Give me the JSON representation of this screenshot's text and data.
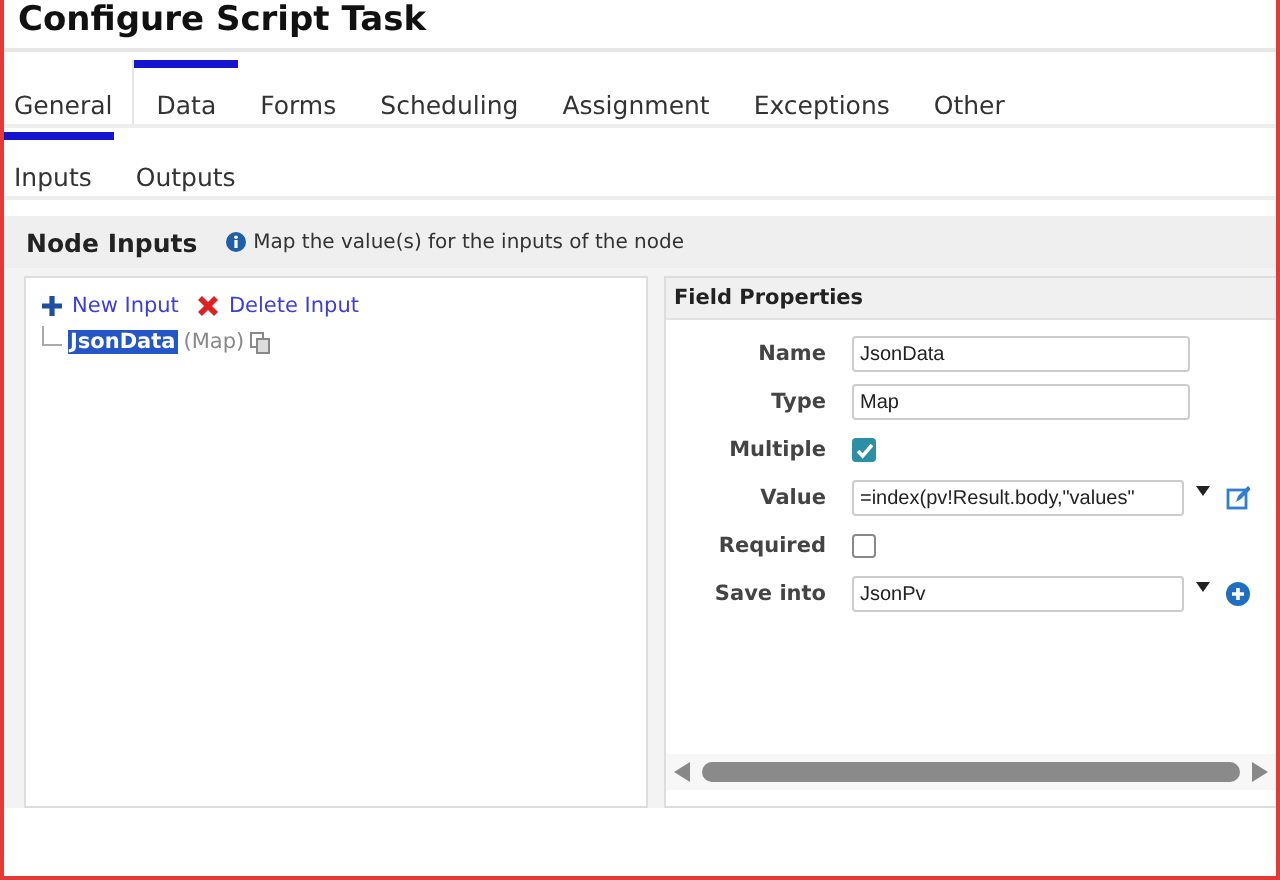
{
  "window": {
    "title": "Configure Script Task"
  },
  "tabs": [
    {
      "label": "General",
      "selected": false
    },
    {
      "label": "Data",
      "selected": true
    },
    {
      "label": "Forms",
      "selected": false
    },
    {
      "label": "Scheduling",
      "selected": false
    },
    {
      "label": "Assignment",
      "selected": false
    },
    {
      "label": "Exceptions",
      "selected": false
    },
    {
      "label": "Other",
      "selected": false
    }
  ],
  "subtabs": [
    {
      "label": "Inputs",
      "selected": true
    },
    {
      "label": "Outputs",
      "selected": false
    }
  ],
  "section": {
    "title": "Node Inputs",
    "hint": "Map the value(s) for the inputs of the node"
  },
  "toolbar": [
    {
      "kind": "add",
      "label": "New Input"
    },
    {
      "kind": "delete",
      "label": "Delete Input"
    }
  ],
  "tree": [
    {
      "name": "JsonData",
      "type": "(Map)",
      "selected": true
    }
  ],
  "properties": {
    "title": "Field Properties",
    "fields": [
      {
        "kind": "text",
        "label": "Name",
        "value": "JsonData"
      },
      {
        "kind": "text",
        "label": "Type",
        "value": "Map"
      },
      {
        "kind": "checkbox",
        "label": "Multiple",
        "checked": true
      },
      {
        "kind": "expression",
        "label": "Value",
        "value": "=index(pv!Result.body,\"values\""
      },
      {
        "kind": "checkbox",
        "label": "Required",
        "checked": false
      },
      {
        "kind": "select",
        "label": "Save into",
        "value": "JsonPv"
      }
    ]
  }
}
